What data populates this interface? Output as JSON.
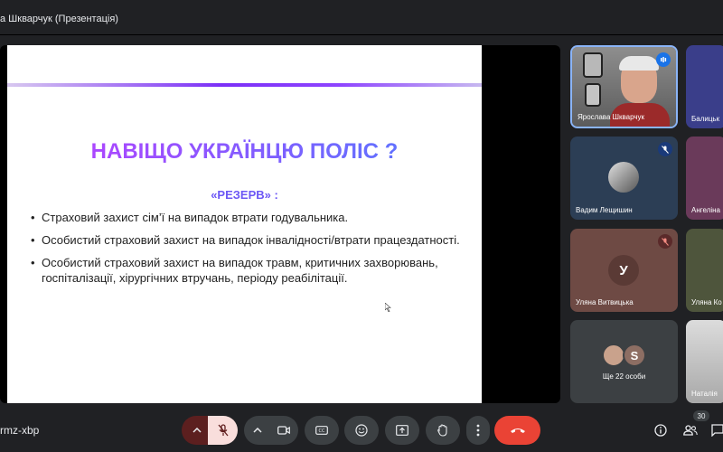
{
  "window": {
    "title": "а Шкварчук (Презентація)"
  },
  "slide": {
    "heading": "НАВІЩО УКРАЇНЦЮ ПОЛІС ?",
    "subheading": "«РЕЗЕРВ» :",
    "bullets": [
      "Страховий захист сім’ї на випадок втрати годувальника.",
      "Особистий страховий захист на випадок інвалідності/втрати працездатності.",
      "Особистий страховий захист на випадок травм, критичних захворювань, госпіталізації, хірургічних втручань, періоду реабілітації."
    ],
    "bullet_char": "•"
  },
  "participants": [
    {
      "name": "Ярослава Шкварчук",
      "speaking": true
    },
    {
      "name": "Балицьк"
    },
    {
      "name": "Вадим Лещишин",
      "muted": true
    },
    {
      "name": "Ангеліна"
    },
    {
      "name": "Уляна Витвицька",
      "initial": "У",
      "muted": true
    },
    {
      "name": "Уляна Ко"
    },
    {
      "name": "Ще 22 особи",
      "initial": "S"
    },
    {
      "name": "Наталія"
    }
  ],
  "meeting": {
    "code": "rmz-xbp",
    "participant_count": "30"
  },
  "colors": {
    "accent_blue": "#8ab4f8",
    "end_call": "#ea4335",
    "mic_off": "#f9dedc"
  }
}
